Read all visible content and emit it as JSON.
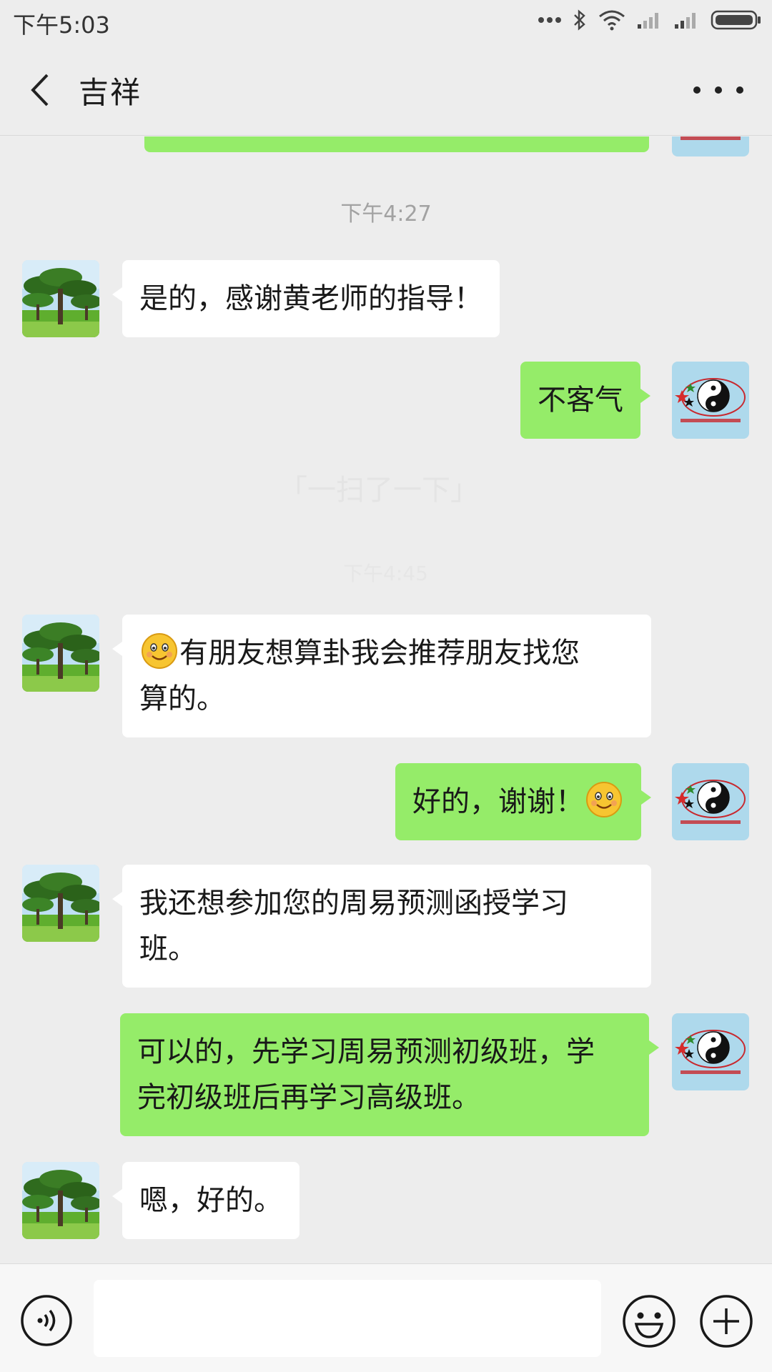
{
  "status_bar": {
    "time": "下午5:03"
  },
  "header": {
    "title": "吉祥"
  },
  "chat": {
    "timestamp_1": "下午4:27",
    "faded_notice": "「一扫了一下」",
    "faded_time": "下午4:45",
    "messages": [
      {
        "side": "in",
        "text": "是的，感谢黄老师的指导！"
      },
      {
        "side": "out",
        "text": "不客气"
      },
      {
        "side": "in",
        "text_line1": "有朋友想算卦我会推荐朋友找您",
        "text_line2": "算的。"
      },
      {
        "side": "out",
        "text": "好的，谢谢！"
      },
      {
        "side": "in",
        "text_line1": "我还想参加您的周易预测函授学习",
        "text_line2": "班。"
      },
      {
        "side": "out",
        "text_line1": "可以的，先学习周易预测初级班，学",
        "text_line2": "完初级班后再学习高级班。"
      },
      {
        "side": "in",
        "text": "嗯，好的。"
      }
    ]
  },
  "input_bar": {
    "placeholder": ""
  },
  "colors": {
    "background": "#ededed",
    "bubble_out": "#95ec69",
    "bubble_in": "#ffffff"
  }
}
